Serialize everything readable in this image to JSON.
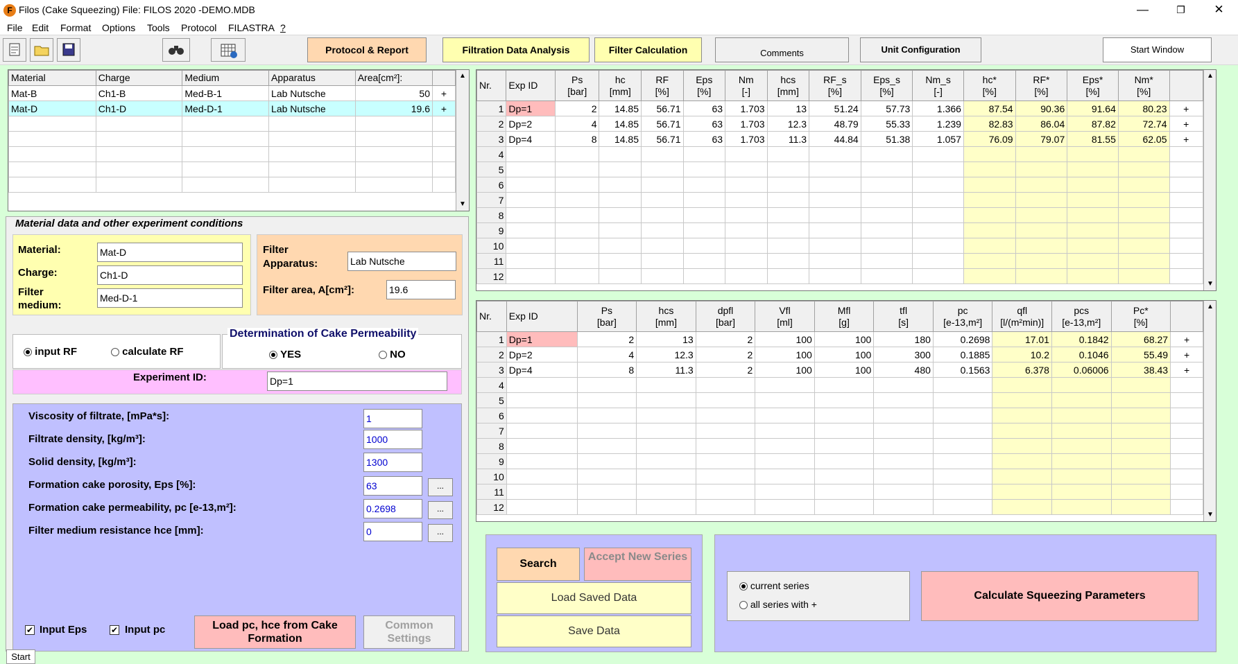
{
  "window": {
    "title": "Filos (Cake Squeezing)   File: FILOS 2020 -DEMO.MDB",
    "min": "—",
    "max": "❐",
    "close": "✕"
  },
  "menu": [
    "File",
    "Edit",
    "Format",
    "Options",
    "Tools",
    "Protocol",
    "FILASTRA",
    "?"
  ],
  "toolbar": {
    "protocol": "Protocol & Report",
    "filtration": "Filtration Data Analysis",
    "filter_calc": "Filter Calculation",
    "comments": "Comments",
    "unit": "Unit Configuration",
    "start": "Start Window"
  },
  "materials": {
    "headers": [
      "Material",
      "Charge",
      "Medium",
      "Apparatus",
      "Area[cm²]:"
    ],
    "rows": [
      [
        "Mat-B",
        "Ch1-B",
        "Med-B-1",
        "Lab  Nutsche",
        "50",
        "+"
      ],
      [
        "Mat-D",
        "Ch1-D",
        "Med-D-1",
        "Lab Nutsche",
        "19.6",
        "+"
      ]
    ]
  },
  "mat_panel": {
    "title": "Material data and  other experiment conditions",
    "material_label": "Material:",
    "material": "Mat-D",
    "charge_label": "Charge:",
    "charge": "Ch1-D",
    "medium_label1": "Filter",
    "medium_label2": "medium:",
    "medium": "Med-D-1",
    "apparatus_label1": "Filter",
    "apparatus_label2": "Apparatus:",
    "apparatus": "Lab Nutsche",
    "area_label": "Filter area, A[cm²]:",
    "area": "19.6"
  },
  "rf": {
    "input": "input RF",
    "calc": "calculate RF"
  },
  "perm": {
    "title": "Determination of Cake Permeability",
    "yes": "YES",
    "no": "NO"
  },
  "exp": {
    "label": "Experiment ID:",
    "value": "Dp=1"
  },
  "params": [
    {
      "label": "Viscosity of filtrate, [mPa*s]:",
      "value": "1"
    },
    {
      "label": "Filtrate density, [kg/m³]:",
      "value": "1000"
    },
    {
      "label": "Solid density, [kg/m³]:",
      "value": "1300"
    },
    {
      "label": "Formation cake porosity, Eps [%]:",
      "value": "63"
    },
    {
      "label": "Formation cake permeability, pc [e-13,m²]:",
      "value": "0.2698"
    },
    {
      "label": "Filter medium resistance hce [mm]:",
      "value": "0"
    }
  ],
  "dots": "...",
  "bottom_left": {
    "input_eps": "Input Eps",
    "input_pc": "Input pc",
    "load": "Load pc, hce from Cake Formation",
    "common": "Common Settings",
    "start": "Start"
  },
  "grid1": {
    "headers": [
      "Nr.",
      "Exp ID",
      "Ps\n[bar]",
      "hc\n[mm]",
      "RF\n[%]",
      "Eps\n[%]",
      "Nm\n[-]",
      "hcs\n[mm]",
      "RF_s\n[%]",
      "Eps_s\n[%]",
      "Nm_s\n[-]",
      "hc*\n[%]",
      "RF*\n[%]",
      "Eps*\n[%]",
      "Nm*\n[%]",
      ""
    ],
    "rows": [
      [
        "1",
        "Dp=1",
        "2",
        "14.85",
        "56.71",
        "63",
        "1.703",
        "13",
        "51.24",
        "57.73",
        "1.366",
        "87.54",
        "90.36",
        "91.64",
        "80.23",
        "+"
      ],
      [
        "2",
        "Dp=2",
        "4",
        "14.85",
        "56.71",
        "63",
        "1.703",
        "12.3",
        "48.79",
        "55.33",
        "1.239",
        "82.83",
        "86.04",
        "87.82",
        "72.74",
        "+"
      ],
      [
        "3",
        "Dp=4",
        "8",
        "14.85",
        "56.71",
        "63",
        "1.703",
        "11.3",
        "44.84",
        "51.38",
        "1.057",
        "76.09",
        "79.07",
        "81.55",
        "62.05",
        "+"
      ]
    ],
    "empty": [
      "4",
      "5",
      "6",
      "7",
      "8",
      "9",
      "10",
      "11",
      "12"
    ]
  },
  "grid2": {
    "headers": [
      "Nr.",
      "Exp ID",
      "Ps\n[bar]",
      "hcs\n[mm]",
      "dpfl\n[bar]",
      "Vfl\n[ml]",
      "Mfl\n[g]",
      "tfl\n[s]",
      "pc\n[e-13,m²]",
      "qfl\n[l/(m²min)]",
      "pcs\n[e-13,m²]",
      "Pc*\n[%]",
      ""
    ],
    "rows": [
      [
        "1",
        "Dp=1",
        "2",
        "13",
        "2",
        "100",
        "100",
        "180",
        "0.2698",
        "17.01",
        "0.1842",
        "68.27",
        "+"
      ],
      [
        "2",
        "Dp=2",
        "4",
        "12.3",
        "2",
        "100",
        "100",
        "300",
        "0.1885",
        "10.2",
        "0.1046",
        "55.49",
        "+"
      ],
      [
        "3",
        "Dp=4",
        "8",
        "11.3",
        "2",
        "100",
        "100",
        "480",
        "0.1563",
        "6.378",
        "0.06006",
        "38.43",
        "+"
      ]
    ],
    "empty": [
      "4",
      "5",
      "6",
      "7",
      "8",
      "9",
      "10",
      "11",
      "12"
    ]
  },
  "actions": {
    "search": "Search",
    "accept": "Accept New Series",
    "load": "Load Saved Data",
    "save": "Save Data",
    "current": "current series",
    "all": "all series with +",
    "calc": "Calculate Squeezing Parameters"
  },
  "colors": {
    "lavender": "#c0c0ff",
    "yellow": "#ffffc8",
    "salmon": "#ffbcbc",
    "pink": "#ffbfff",
    "orange": "#ffd8b0",
    "green": "#d8ffd8"
  }
}
